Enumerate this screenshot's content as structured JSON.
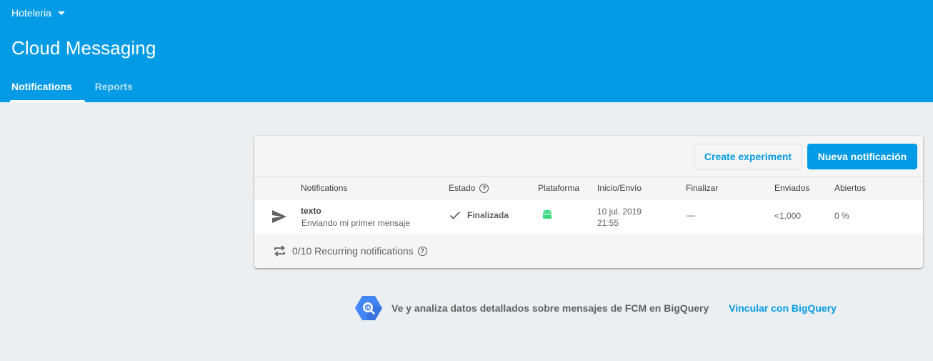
{
  "header": {
    "project_name": "Hoteleria",
    "title": "Cloud Messaging",
    "tabs": [
      {
        "label": "Notifications",
        "active": true
      },
      {
        "label": "Reports",
        "active": false
      }
    ],
    "color": "#039be5"
  },
  "toolbar": {
    "create_experiment_label": "Create experiment",
    "new_notification_label": "Nueva notificación"
  },
  "table": {
    "columns": [
      "Notifications",
      "Estado",
      "Plataforma",
      "Inicio/Envío",
      "Finalizar",
      "Enviados",
      "Abiertos"
    ],
    "rows": [
      {
        "icon": "send-icon",
        "title": "texto",
        "subtitle": "Enviando mi primer mensaje",
        "status": "Finalizada",
        "platform": "android-icon",
        "start_date": "10 jul. 2019",
        "start_time": "21:55",
        "end": "—",
        "sent": "<1,000",
        "opened": "0 %"
      }
    ]
  },
  "recurring": {
    "text": "0/10 Recurring notifications"
  },
  "bigquery": {
    "text": "Ve y analiza datos detallados sobre mensajes de FCM en BigQuery",
    "link": "Vincular con BigQuery",
    "icon": "bigquery-icon"
  },
  "colors": {
    "accent": "#039be5",
    "android": "#3ddc84",
    "background": "#eceff1"
  }
}
